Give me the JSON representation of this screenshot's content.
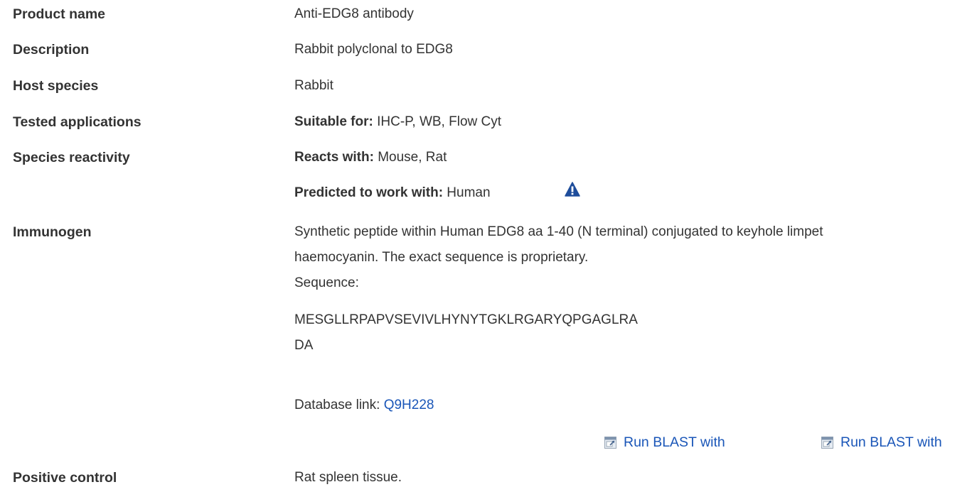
{
  "rows": {
    "product_name": {
      "label": "Product name",
      "value": "Anti-EDG8 antibody"
    },
    "description": {
      "label": "Description",
      "value": "Rabbit polyclonal to EDG8"
    },
    "host_species": {
      "label": "Host species",
      "value": "Rabbit"
    },
    "tested_applications": {
      "label": "Tested applications",
      "prefix": "Suitable for:",
      "value": " IHC-P, WB, Flow Cyt"
    },
    "species_reactivity": {
      "label": "Species reactivity",
      "reacts_prefix": "Reacts with:",
      "reacts_value": " Mouse, Rat",
      "predicted_prefix": "Predicted to work with:",
      "predicted_value": " Human",
      "warning_icon": "warning-triangle-icon"
    },
    "immunogen": {
      "label": "Immunogen",
      "line1": "Synthetic peptide within Human EDG8 aa 1-40 (N terminal) conjugated to keyhole limpet",
      "line2": "haemocyanin. The exact sequence is proprietary.",
      "line3": "Sequence:",
      "sequence_line1": "MESGLLRPAPVSEVIVLHYNYTGKLRGARYQPGAGLRA",
      "sequence_line2": "DA",
      "db_prefix": "Database link: ",
      "db_link": "Q9H228",
      "blast_buttons": [
        {
          "label": "Run BLAST with",
          "icon": "external-link-icon"
        },
        {
          "label": "Run BLAST with",
          "icon": "external-link-icon"
        }
      ]
    },
    "positive_control": {
      "label": "Positive control",
      "value": "Rat spleen tissue."
    }
  },
  "colors": {
    "text": "#333333",
    "link": "#1a56b8",
    "warning_icon": "#1e4d9b"
  }
}
